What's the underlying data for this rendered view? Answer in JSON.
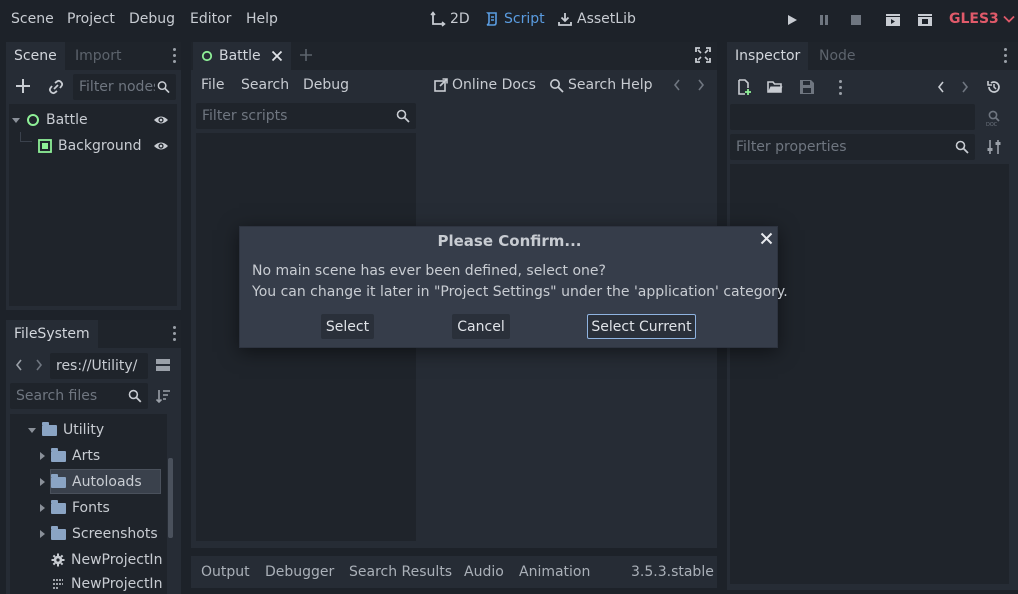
{
  "menubar": {
    "items": [
      "Scene",
      "Project",
      "Debug",
      "Editor",
      "Help"
    ],
    "workspaces": [
      {
        "label": "2D",
        "icon": "2d-icon",
        "active": false
      },
      {
        "label": "Script",
        "icon": "script-icon",
        "active": true
      },
      {
        "label": "AssetLib",
        "icon": "assetlib-icon",
        "active": false
      }
    ],
    "renderer": "GLES3"
  },
  "scene_dock": {
    "tabs": [
      "Scene",
      "Import"
    ],
    "filter_placeholder": "Filter nodes",
    "nodes": [
      {
        "label": "Battle",
        "icon": "node-icon"
      },
      {
        "label": "Background",
        "icon": "texture-rect-icon"
      }
    ]
  },
  "filesystem_dock": {
    "tab": "FileSystem",
    "path": "res://Utility/",
    "search_placeholder": "Search files",
    "items": [
      {
        "label": "Utility",
        "type": "folder",
        "expanded": true
      },
      {
        "label": "Arts",
        "type": "folder"
      },
      {
        "label": "Autoloads",
        "type": "folder",
        "selected": true
      },
      {
        "label": "Fonts",
        "type": "folder"
      },
      {
        "label": "Screenshots",
        "type": "folder"
      },
      {
        "label": "NewProjectIn",
        "type": "gear-file"
      },
      {
        "label": "NewProjectIn",
        "type": "file"
      }
    ]
  },
  "script_editor": {
    "tab": "Battle",
    "menus": [
      "File",
      "Search",
      "Debug"
    ],
    "online_docs": "Online Docs",
    "search_help": "Search Help",
    "filter_scripts_placeholder": "Filter scripts"
  },
  "inspector": {
    "tabs": [
      "Inspector",
      "Node"
    ],
    "filter_placeholder": "Filter properties"
  },
  "bottom_panel": {
    "tabs": [
      "Output",
      "Debugger",
      "Search Results",
      "Audio",
      "Animation"
    ],
    "version": "3.5.3.stable"
  },
  "dialog": {
    "title": "Please Confirm...",
    "line1": "No main scene has ever been defined, select one?",
    "line2": "You can change it later in \"Project Settings\" under the 'application' category.",
    "buttons": {
      "select": "Select",
      "cancel": "Cancel",
      "select_current": "Select Current"
    }
  },
  "colors": {
    "accent": "#5a9ce0",
    "renderer": "#e05a6a",
    "background": "#1d2229",
    "panel": "#262c35",
    "dialog": "#363d4a"
  }
}
